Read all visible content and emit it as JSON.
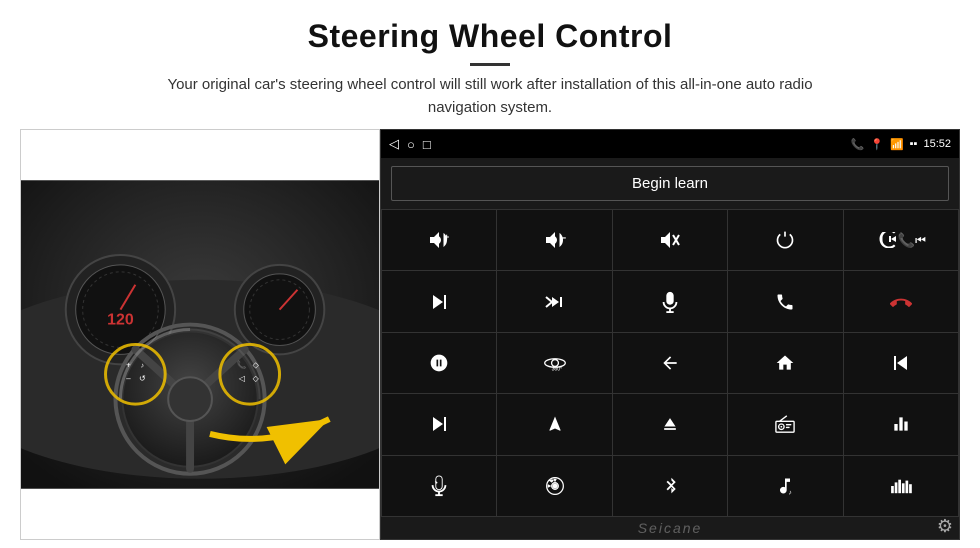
{
  "page": {
    "title": "Steering Wheel Control",
    "divider": true,
    "subtitle": "Your original car's steering wheel control will still work after installation of this all-in-one auto radio navigation system."
  },
  "statusBar": {
    "left": [
      "◁",
      "○",
      "□"
    ],
    "right_icons": [
      "📞",
      "📍",
      "📶"
    ],
    "time": "15:52",
    "signal": "▪▪"
  },
  "beginLearn": {
    "label": "Begin learn"
  },
  "controls": [
    {
      "icon": "🔊+",
      "name": "vol-up"
    },
    {
      "icon": "🔊–",
      "name": "vol-down"
    },
    {
      "icon": "🔇",
      "name": "mute"
    },
    {
      "icon": "⏻",
      "name": "power"
    },
    {
      "icon": "📞⏮",
      "name": "call-prev"
    },
    {
      "icon": "⏭",
      "name": "next"
    },
    {
      "icon": "⏩⏭",
      "name": "ff-next"
    },
    {
      "icon": "🎤",
      "name": "mic"
    },
    {
      "icon": "📞",
      "name": "call"
    },
    {
      "icon": "📞↩",
      "name": "hang-up"
    },
    {
      "icon": "📢",
      "name": "speaker"
    },
    {
      "icon": "360°",
      "name": "camera-360"
    },
    {
      "icon": "↺",
      "name": "back"
    },
    {
      "icon": "🏠",
      "name": "home"
    },
    {
      "icon": "⏮⏮",
      "name": "prev-prev"
    },
    {
      "icon": "⏭⏭",
      "name": "fast-fwd"
    },
    {
      "icon": "▶",
      "name": "nav"
    },
    {
      "icon": "⏏",
      "name": "eject"
    },
    {
      "icon": "📻",
      "name": "radio"
    },
    {
      "icon": "⚙",
      "name": "equalizer"
    },
    {
      "icon": "🎤",
      "name": "mic2"
    },
    {
      "icon": "⚙",
      "name": "settings"
    },
    {
      "icon": "✱",
      "name": "bluetooth"
    },
    {
      "icon": "🎵",
      "name": "music"
    },
    {
      "icon": "📊",
      "name": "spectrum"
    }
  ],
  "watermark": {
    "text": "Seicane"
  },
  "gear": "⚙"
}
